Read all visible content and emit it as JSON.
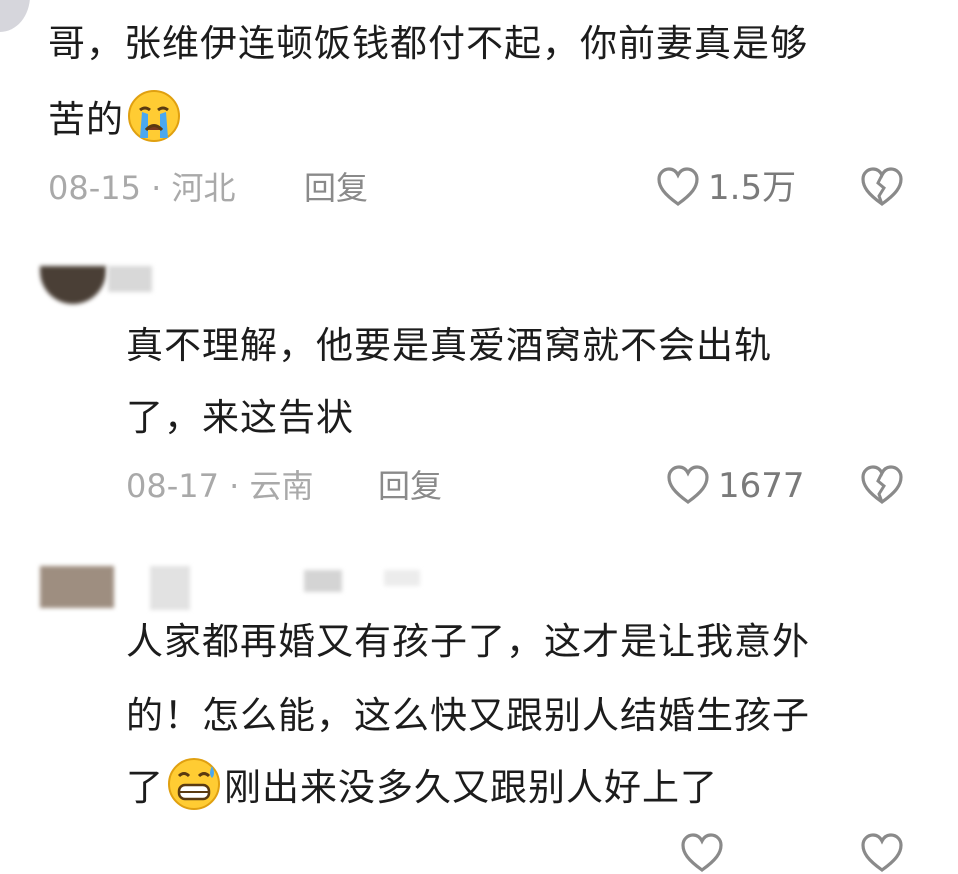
{
  "comments": [
    {
      "lines": [
        "哥，张维伊连顿饭钱都付不起，你前妻真是够",
        "苦的"
      ],
      "emoji_after_line2": "crying-face-emoji",
      "date": "08-15",
      "location": "河北",
      "reply_label": "回复",
      "likes": "1.5万"
    },
    {
      "lines": [
        "真不理解，他要是真爱酒窝就不会出轨",
        "了，来这告状"
      ],
      "date": "08-17",
      "location": "云南",
      "reply_label": "回复",
      "likes": "1677"
    },
    {
      "lines": [
        "人家都再婚又有孩子了，这才是让我意外",
        "的！怎么能，这么快又跟别人结婚生孩子",
        "刚出来没多久又跟别人好上了"
      ],
      "line3_prefix": "了",
      "emoji_line3": "grinning-sweat-emoji"
    }
  ],
  "separator": "·",
  "colors": {
    "text": "#1c1c1c",
    "meta": "#a9a9a9",
    "icon": "#8a8a8a"
  }
}
